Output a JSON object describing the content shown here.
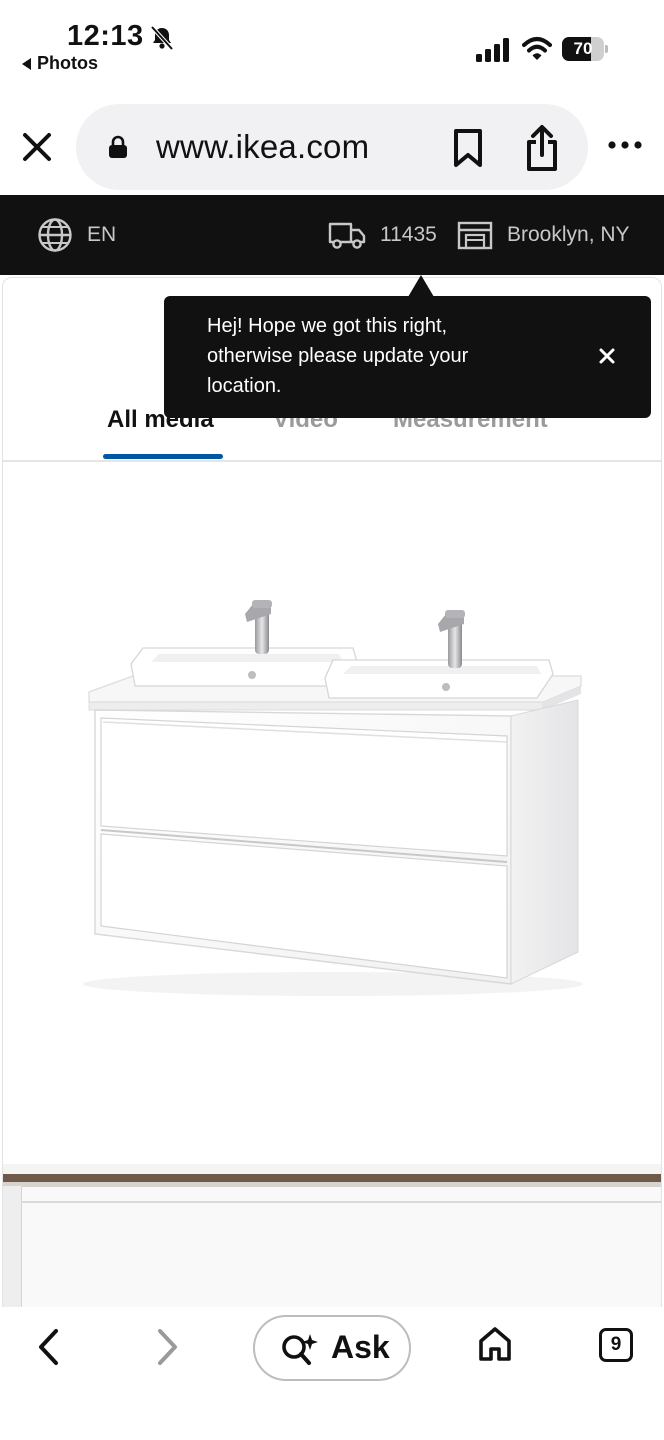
{
  "status_bar": {
    "time": "12:13",
    "back_app": "Photos",
    "battery_level": 70,
    "battery_label": "70"
  },
  "browser": {
    "url": "www.ikea.com",
    "open_tabs": "9"
  },
  "ikea_strip": {
    "language": "EN",
    "zip_code": "11435",
    "store": "Brooklyn, NY"
  },
  "media_tabs": [
    {
      "label": "All media",
      "active": true
    },
    {
      "label": "Video",
      "active": false
    },
    {
      "label": "Measurement",
      "active": false
    }
  ],
  "tooltip": {
    "message": "Hej! Hope we got this right, otherwise please update your location."
  },
  "toolbar": {
    "ask_label": "Ask"
  },
  "colors": {
    "strip_bg": "#111111",
    "tab_indicator": "#0058a3",
    "tooltip_bg": "#111111"
  }
}
